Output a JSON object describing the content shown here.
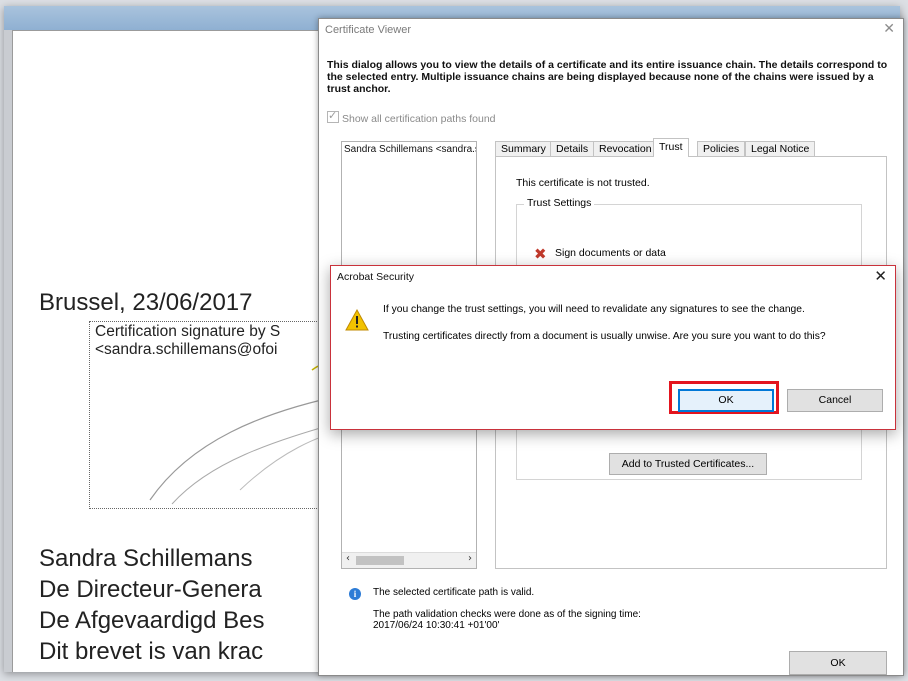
{
  "document": {
    "date_line": "Brussel, 23/06/2017",
    "sig_line1": "Certification signature by S",
    "sig_line2": "<sandra.schillemans@ofoi",
    "body_lines": [
      "Sandra Schillemans",
      "De Directeur-Genera",
      "De Afgevaardigd Bes",
      "Dit brevet is van krac"
    ]
  },
  "certificate_viewer": {
    "title": "Certificate Viewer",
    "description": "This dialog allows you to view the details of a certificate and its entire issuance chain. The details correspond to the selected entry. Multiple issuance chains are being displayed because none of the chains were issued by a trust anchor.",
    "show_all_label": "Show all certification paths found",
    "tree_item": "Sandra Schillemans <sandra.s",
    "tabs": [
      "Summary",
      "Details",
      "Revocation",
      "Trust",
      "Policies",
      "Legal Notice"
    ],
    "active_tab": "Trust",
    "not_trusted": "This certificate is not trusted.",
    "trust_settings_label": "Trust Settings",
    "sign_docs_label": "Sign documents or data",
    "add_trusted_button": "Add to Trusted Certificates...",
    "path_valid": "The selected certificate path is valid.",
    "path_checks_line1": "The path validation checks were done as of the signing time:",
    "path_checks_line2": "2017/06/24 10:30:41 +01'00'",
    "ok_button": "OK"
  },
  "acrobat_security": {
    "title": "Acrobat Security",
    "message1": "If you change the trust settings, you will need to revalidate any signatures to see the change.",
    "message2": "Trusting certificates directly from a document is usually unwise. Are you sure you want to do this?",
    "ok_button": "OK",
    "cancel_button": "Cancel"
  },
  "icons": {
    "close": "close-icon",
    "warning": "warning-icon",
    "info": "info-icon",
    "deny": "red-x-icon"
  },
  "colors": {
    "highlight": "#e3151f",
    "accent": "#0078d7"
  }
}
